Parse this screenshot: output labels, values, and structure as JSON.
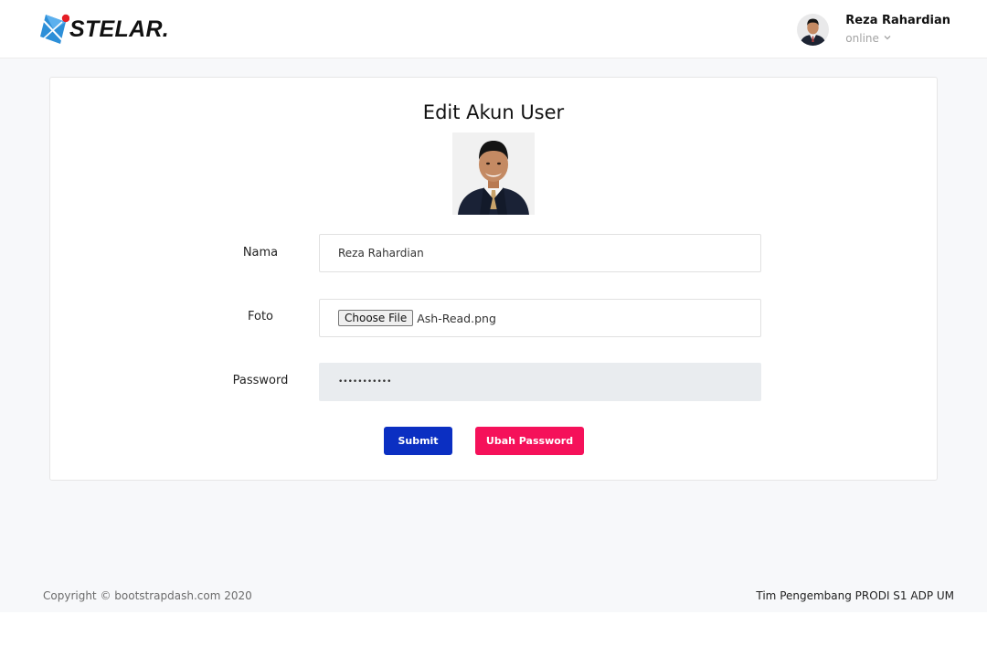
{
  "navbar": {
    "brand": "STELAR.",
    "user_name": "Reza Rahardian",
    "user_status": "online",
    "colors": {
      "brand_blue": "#2d8fd8",
      "brand_dot": "#e51e25"
    }
  },
  "card": {
    "title": "Edit Akun User",
    "fields": {
      "nama_label": "Nama",
      "nama_value": "Reza Rahardian",
      "foto_label": "Foto",
      "file_button": "Choose File",
      "file_name": "Ash-Read.png",
      "password_label": "Password",
      "password_value": "•••••••••••"
    },
    "buttons": {
      "submit": "Submit",
      "ubah_password": "Ubah Password"
    },
    "colors": {
      "submit": "#0b2fc2",
      "ubah_password": "#f5115a"
    }
  },
  "footer": {
    "copyright": "Copyright © bootstrapdash.com 2020",
    "credit": "Tim Pengembang PRODI S1 ADP UM"
  }
}
